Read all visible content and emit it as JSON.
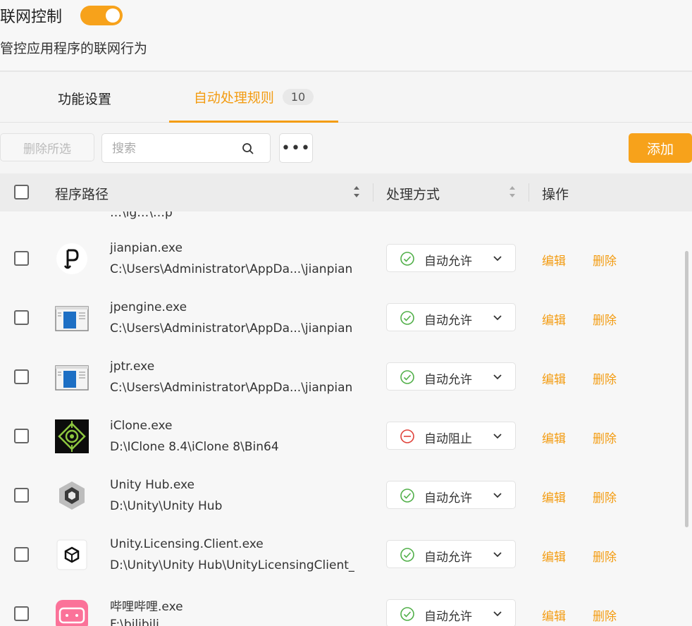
{
  "header": {
    "title": "联网控制",
    "subtitle": "管控应用程序的联网行为",
    "toggle_on": true,
    "accent": "#f7a21b"
  },
  "tabs": [
    {
      "label": "功能设置",
      "active": false
    },
    {
      "label": "自动处理规则",
      "active": true,
      "badge": "10"
    }
  ],
  "toolbar": {
    "delete_selected_label": "删除所选",
    "search_placeholder": "搜索",
    "more_label": "•••",
    "add_label": "添加"
  },
  "table": {
    "headers": {
      "path": "程序路径",
      "method": "处理方式",
      "ops": "操作"
    },
    "partial_row_text": "…\\ig…\\…p",
    "rows": [
      {
        "name": "jianpian.exe",
        "path": "C:\\Users\\Administrator\\AppDa...\\jianpian",
        "icon": "jianpian-logo-icon",
        "method": "自动允许",
        "status": "allow",
        "edit": "编辑",
        "delete": "删除"
      },
      {
        "name": "jpengine.exe",
        "path": "C:\\Users\\Administrator\\AppDa...\\jianpian",
        "icon": "window-app-icon",
        "method": "自动允许",
        "status": "allow",
        "edit": "编辑",
        "delete": "删除"
      },
      {
        "name": "jptr.exe",
        "path": "C:\\Users\\Administrator\\AppDa...\\jianpian",
        "icon": "window-app-icon",
        "method": "自动允许",
        "status": "allow",
        "edit": "编辑",
        "delete": "删除"
      },
      {
        "name": "iClone.exe",
        "path": "D:\\IClone 8.4\\iClone 8\\Bin64",
        "icon": "iclone-logo-icon",
        "method": "自动阻止",
        "status": "block",
        "edit": "编辑",
        "delete": "删除"
      },
      {
        "name": "Unity Hub.exe",
        "path": "D:\\Unity\\Unity Hub",
        "icon": "unity-hub-logo-icon",
        "method": "自动允许",
        "status": "allow",
        "edit": "编辑",
        "delete": "删除"
      },
      {
        "name": "Unity.Licensing.Client.exe",
        "path": "D:\\Unity\\Unity Hub\\UnityLicensingClient_",
        "icon": "unity-logo-icon",
        "method": "自动允许",
        "status": "allow",
        "edit": "编辑",
        "delete": "删除"
      },
      {
        "name": "哔哩哔哩.exe",
        "path": "F:\\bilibili",
        "icon": "bilibili-logo-icon",
        "method": "自动允许",
        "status": "allow",
        "edit": "编辑",
        "delete": "删除"
      }
    ]
  },
  "colors": {
    "allow": "#52b04a",
    "block": "#e0433b",
    "link": "#f39c12"
  }
}
